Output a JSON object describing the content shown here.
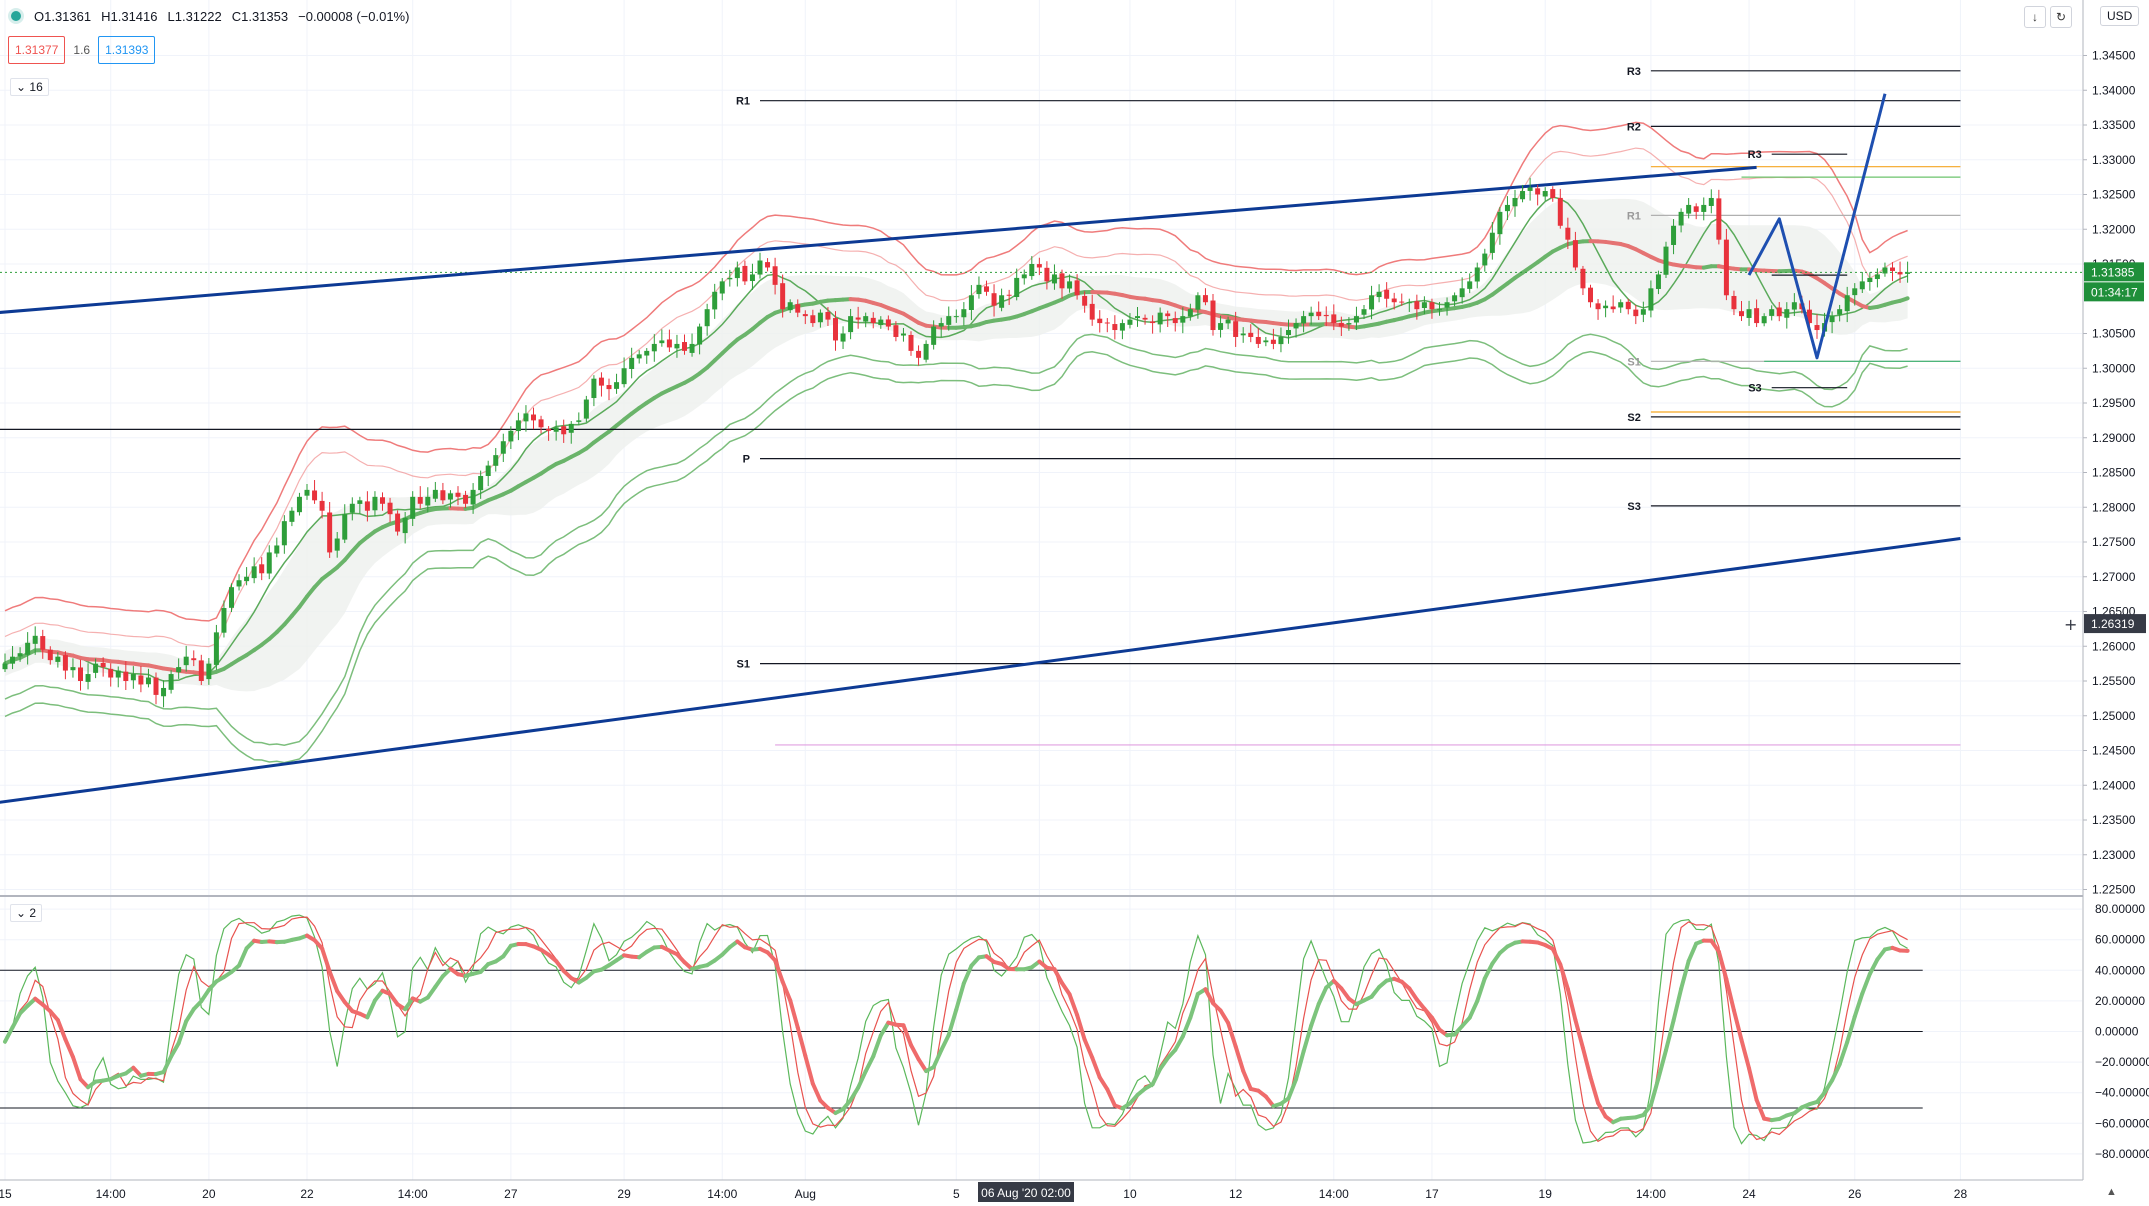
{
  "header": {
    "ohlc": {
      "open": "O1.31361",
      "high": "H1.31416",
      "low": "L1.31222",
      "close": "C1.31353",
      "change": "−0.00008 (−0.01%)"
    },
    "bid_price": "1.31377",
    "spread": "1.6",
    "ask_price": "1.31393",
    "main_indicator_label": "16",
    "sub_indicator_label": "2",
    "currency": "USD",
    "icon_names": [
      "download-icon",
      "refresh-icon",
      "plus-icon",
      "auto-scale-icon"
    ]
  },
  "colors": {
    "up": "#26a69a",
    "down": "#ef5350",
    "bull_candle": "#2e9e3a",
    "bear_candle": "#e8323c",
    "trendline": "#0d3a94",
    "band_red": "#ef7b7b",
    "band_green": "#7cbe7c"
  },
  "chart_data": [
    {
      "type": "candlestick",
      "price_scale": [
        "1.34500",
        "1.34000",
        "1.33500",
        "1.33000",
        "1.32500",
        "1.32000",
        "1.31500",
        "1.30500",
        "1.30000",
        "1.29500",
        "1.29000",
        "1.28500",
        "1.28000",
        "1.27500",
        "1.27000",
        "1.26500",
        "1.26000",
        "1.25500",
        "1.25000",
        "1.24500",
        "1.24000",
        "1.23500",
        "1.23000",
        "1.22500"
      ],
      "ylim": [
        1.2215,
        1.3495
      ],
      "time_labels": [
        {
          "i": 0,
          "label": "15"
        },
        {
          "i": 14,
          "label": "14:00"
        },
        {
          "i": 27,
          "label": "20"
        },
        {
          "i": 40,
          "label": "22"
        },
        {
          "i": 54,
          "label": "14:00"
        },
        {
          "i": 67,
          "label": "27"
        },
        {
          "i": 82,
          "label": "29"
        },
        {
          "i": 95,
          "label": "14:00"
        },
        {
          "i": 106,
          "label": "Aug"
        },
        {
          "i": 126,
          "label": "5"
        },
        {
          "i": 137,
          "label": "14:00"
        },
        {
          "i": 149,
          "label": "10"
        },
        {
          "i": 163,
          "label": "12"
        },
        {
          "i": 176,
          "label": "14:00"
        },
        {
          "i": 189,
          "label": "17"
        },
        {
          "i": 204,
          "label": "19"
        },
        {
          "i": 218,
          "label": "14:00"
        },
        {
          "i": 231,
          "label": "24"
        },
        {
          "i": 245,
          "label": "26"
        },
        {
          "i": 259,
          "label": "28"
        }
      ],
      "crosshair_time": "06 Aug '20  02:00",
      "crosshair_price": "1.26319",
      "last_price": "1.31385",
      "countdown": "01:34:17",
      "closes": [
        1.2575,
        1.2585,
        1.259,
        1.2605,
        1.2615,
        1.2595,
        1.258,
        1.2585,
        1.2565,
        1.257,
        1.255,
        1.256,
        1.2575,
        1.257,
        1.2555,
        1.2565,
        1.255,
        1.256,
        1.2545,
        1.2555,
        1.253,
        1.254,
        1.256,
        1.257,
        1.2585,
        1.258,
        1.255,
        1.2575,
        1.262,
        1.2655,
        1.2685,
        1.2695,
        1.27,
        1.2715,
        1.2705,
        1.2735,
        1.2745,
        1.278,
        1.2795,
        1.2815,
        1.2825,
        1.281,
        1.2795,
        1.2735,
        1.2755,
        1.279,
        1.2805,
        1.281,
        1.2795,
        1.2815,
        1.2805,
        1.279,
        1.2765,
        1.2785,
        1.2815,
        1.2805,
        1.2815,
        1.2825,
        1.281,
        1.282,
        1.2815,
        1.2805,
        1.2825,
        1.2845,
        1.286,
        1.2875,
        1.2895,
        1.291,
        1.2925,
        1.2935,
        1.2925,
        1.2915,
        1.291,
        1.2915,
        1.2905,
        1.292,
        1.2925,
        1.2955,
        1.2985,
        1.2975,
        1.297,
        1.298,
        1.3,
        1.3015,
        1.302,
        1.3025,
        1.3035,
        1.304,
        1.303,
        1.3035,
        1.3025,
        1.3035,
        1.306,
        1.3085,
        1.311,
        1.3125,
        1.313,
        1.3145,
        1.3125,
        1.3135,
        1.3155,
        1.3145,
        1.312,
        1.3085,
        1.3095,
        1.308,
        1.3075,
        1.3065,
        1.308,
        1.307,
        1.304,
        1.305,
        1.3075,
        1.307,
        1.3075,
        1.3065,
        1.307,
        1.306,
        1.3045,
        1.305,
        1.3025,
        1.3015,
        1.3035,
        1.306,
        1.3065,
        1.3075,
        1.3075,
        1.3085,
        1.3105,
        1.312,
        1.311,
        1.309,
        1.3105,
        1.3105,
        1.313,
        1.3135,
        1.315,
        1.3145,
        1.3125,
        1.3135,
        1.3115,
        1.3125,
        1.3105,
        1.309,
        1.307,
        1.3065,
        1.3065,
        1.3055,
        1.3065,
        1.307,
        1.3075,
        1.307,
        1.3065,
        1.308,
        1.3075,
        1.3065,
        1.3075,
        1.3085,
        1.3105,
        1.3095,
        1.3055,
        1.3065,
        1.307,
        1.3045,
        1.305,
        1.3045,
        1.3035,
        1.304,
        1.3035,
        1.3045,
        1.3055,
        1.3065,
        1.3075,
        1.308,
        1.3075,
        1.3075,
        1.3065,
        1.306,
        1.3065,
        1.3075,
        1.3085,
        1.3105,
        1.311,
        1.31,
        1.3095,
        1.3095,
        1.3095,
        1.3085,
        1.3095,
        1.3085,
        1.3085,
        1.3095,
        1.3105,
        1.3115,
        1.3125,
        1.3145,
        1.3165,
        1.3195,
        1.3225,
        1.3235,
        1.3245,
        1.3255,
        1.326,
        1.325,
        1.3255,
        1.3245,
        1.3205,
        1.3185,
        1.3145,
        1.3115,
        1.3095,
        1.3085,
        1.309,
        1.3085,
        1.3095,
        1.3085,
        1.3075,
        1.3085,
        1.3115,
        1.3135,
        1.3175,
        1.3205,
        1.3225,
        1.3235,
        1.3225,
        1.3235,
        1.3245,
        1.3185,
        1.3105,
        1.3085,
        1.3075,
        1.3085,
        1.3065,
        1.3075,
        1.3085,
        1.3075,
        1.3085,
        1.3095,
        1.3085,
        1.3065,
        1.3055,
        1.3065,
        1.3075,
        1.3085,
        1.3105,
        1.3115,
        1.3125,
        1.313,
        1.3135,
        1.3145,
        1.314,
        1.3135,
        1.3138
      ],
      "trendlines": [
        {
          "from": [
            -1,
            1.308
          ],
          "to": [
            232,
            1.3289
          ]
        },
        {
          "from": [
            -1,
            1.2375
          ],
          "to": [
            259,
            1.2755
          ]
        }
      ],
      "projection": [
        [
          231,
          1.3134
        ],
        [
          235,
          1.3215
        ],
        [
          240,
          1.3015
        ],
        [
          249,
          1.3395
        ]
      ],
      "pivot_levels": [
        {
          "label": "R1",
          "price": 1.3385,
          "from": 100,
          "to": 259,
          "color": "#131722"
        },
        {
          "label": "P",
          "price": 1.287,
          "from": 100,
          "to": 259,
          "color": "#131722"
        },
        {
          "label": "S1",
          "price": 1.2575,
          "from": 100,
          "to": 259,
          "color": "#131722"
        },
        {
          "label": "",
          "price": 1.2458,
          "from": 102,
          "to": 259,
          "color": "#e0a0e0"
        },
        {
          "label": "",
          "price": 1.2912,
          "from": -1,
          "to": 259,
          "color": "#131722"
        },
        {
          "label": "R3",
          "price": 1.3428,
          "from": 218,
          "to": 259,
          "color": "#131722"
        },
        {
          "label": "R2",
          "price": 1.3348,
          "from": 218,
          "to": 259,
          "color": "#131722"
        },
        {
          "label": "S3",
          "price": 1.2802,
          "from": 218,
          "to": 259,
          "color": "#131722"
        },
        {
          "label": "S2",
          "price": 1.293,
          "from": 218,
          "to": 259,
          "color": "#131722"
        },
        {
          "label": "",
          "price": 1.2937,
          "from": 218,
          "to": 259,
          "color": "#f5a623"
        },
        {
          "label": "",
          "price": 1.329,
          "from": 218,
          "to": 259,
          "color": "#f5a623"
        },
        {
          "label": "",
          "price": 1.3275,
          "from": 230,
          "to": 259,
          "color": "#6cc46c"
        },
        {
          "label": "R1",
          "price": 1.322,
          "from": 218,
          "to": 259,
          "color": "#b0b0b0"
        },
        {
          "label": "S1",
          "price": 1.301,
          "from": 218,
          "to": 259,
          "color": "#b0b0b0"
        },
        {
          "label": "",
          "price": 1.301,
          "from": 233,
          "to": 259,
          "color": "#3cb371"
        },
        {
          "label": "R3",
          "price": 1.3308,
          "from": 234,
          "to": 244,
          "color": "#131722"
        },
        {
          "label": "S3",
          "price": 1.2972,
          "from": 234,
          "to": 244,
          "color": "#131722"
        },
        {
          "label": "",
          "price": 1.3134,
          "from": 234,
          "to": 244,
          "color": "#131722"
        }
      ]
    },
    {
      "type": "line",
      "name": "",
      "scale": [
        "80.00000",
        "60.00000",
        "40.00000",
        "20.00000",
        "0.00000",
        "−20.00000",
        "−40.00000",
        "−60.00000",
        "−80.00000"
      ],
      "ylim": [
        -88,
        88
      ],
      "levels": [
        40,
        0,
        -50
      ]
    }
  ]
}
